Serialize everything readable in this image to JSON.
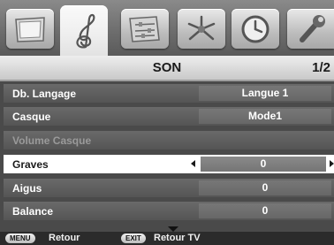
{
  "tabs": [
    {
      "name": "picture",
      "icon": "picture-tv-icon",
      "active": false
    },
    {
      "name": "sound",
      "icon": "music-clef-icon",
      "active": true
    },
    {
      "name": "settings",
      "icon": "settings-sliders-icon",
      "active": false
    },
    {
      "name": "connections",
      "icon": "network-arrows-icon",
      "active": false
    },
    {
      "name": "timer",
      "icon": "clock-icon",
      "active": false
    },
    {
      "name": "setup",
      "icon": "wrench-icon",
      "active": false
    }
  ],
  "header": {
    "title": "SON",
    "page": "1/2"
  },
  "menu": {
    "items": [
      {
        "label": "Db. Langage",
        "value": "Langue 1",
        "state": "normal"
      },
      {
        "label": "Casque",
        "value": "Mode1",
        "state": "normal"
      },
      {
        "label": "Volume Casque",
        "value": "",
        "state": "disabled"
      },
      {
        "label": "Graves",
        "value": "0",
        "state": "selected"
      },
      {
        "label": "Aigus",
        "value": "0",
        "state": "normal"
      },
      {
        "label": "Balance",
        "value": "0",
        "state": "normal"
      }
    ]
  },
  "footer": {
    "menu_key": "MENU",
    "menu_label": "Retour",
    "exit_key": "EXIT",
    "exit_label": "Retour TV"
  }
}
